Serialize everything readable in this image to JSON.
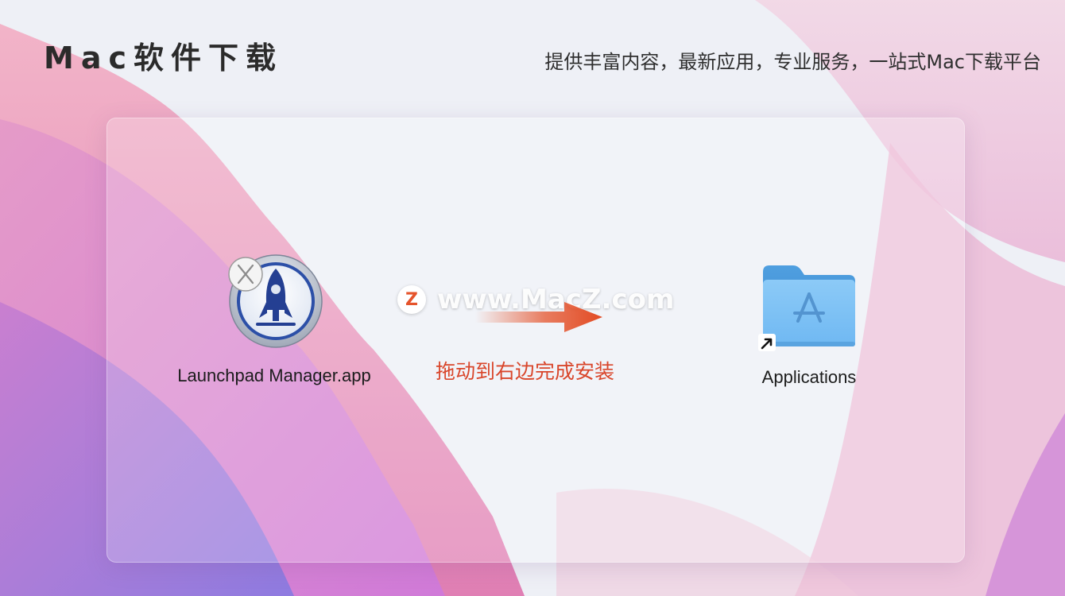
{
  "header": {
    "brand_title": "Mac软件下载",
    "slogan": "提供丰富内容，最新应用，专业服务，一站式Mac下载平台"
  },
  "installer": {
    "app": {
      "label": "Launchpad Manager.app",
      "icon": "rocket-icon"
    },
    "watermark": {
      "logo_letter": "Z",
      "text": "www.MacZ.com"
    },
    "hint": "拖动到右边完成安装",
    "target": {
      "label": "Applications",
      "icon": "applications-folder-icon"
    }
  },
  "colors": {
    "hint_red": "#d9462b",
    "arrow_orange": "#e5532b",
    "folder_blue": "#6fb8f2"
  }
}
